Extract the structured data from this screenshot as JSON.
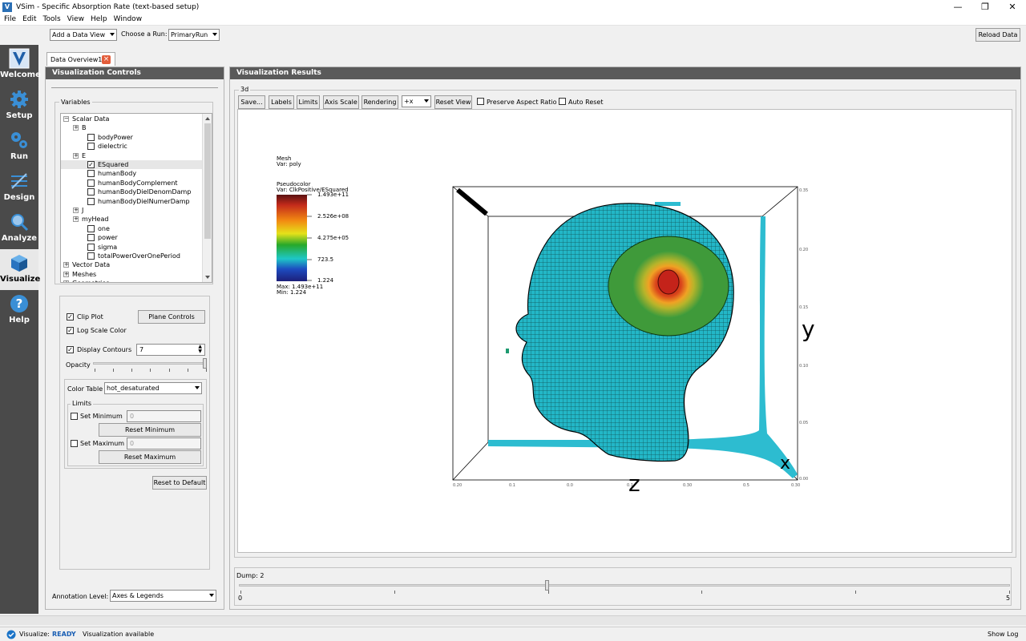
{
  "window": {
    "app_icon": "V",
    "title": "VSim - Specific Absorption Rate (text-based setup)",
    "controls": [
      "—",
      "❐",
      "✕"
    ]
  },
  "menu": [
    "File",
    "Edit",
    "Tools",
    "View",
    "Help",
    "Window"
  ],
  "toolbar": {
    "add_view": "Add a Data View",
    "choose_run_label": "Choose a Run:",
    "run_value": "PrimaryRun",
    "reload": "Reload Data"
  },
  "sidebar": {
    "items": [
      {
        "label": "Welcome",
        "icon": "vsim-logo-icon"
      },
      {
        "label": "Setup",
        "icon": "gear-icon"
      },
      {
        "label": "Run",
        "icon": "gears-icon"
      },
      {
        "label": "Design",
        "icon": "design-icon"
      },
      {
        "label": "Analyze",
        "icon": "magnifier-icon"
      },
      {
        "label": "Visualize",
        "icon": "cube-icon"
      },
      {
        "label": "Help",
        "icon": "question-icon"
      }
    ]
  },
  "tab": {
    "label": "Data Overview1"
  },
  "controls_panel": {
    "title": "Visualization Controls",
    "variables_label": "Variables",
    "tree": [
      {
        "indent": 0,
        "exp": "⊟",
        "label": "Scalar Data"
      },
      {
        "indent": 1,
        "exp": "⊞",
        "label": "B"
      },
      {
        "indent": 2,
        "cb": "",
        "label": "bodyPower"
      },
      {
        "indent": 2,
        "cb": "",
        "label": "dielectric"
      },
      {
        "indent": 1,
        "exp": "⊞",
        "label": "E"
      },
      {
        "indent": 2,
        "cb": "✓",
        "label": "ESquared",
        "sel": true
      },
      {
        "indent": 2,
        "cb": "",
        "label": "humanBody"
      },
      {
        "indent": 2,
        "cb": "",
        "label": "humanBodyComplement"
      },
      {
        "indent": 2,
        "cb": "",
        "label": "humanBodyDielDenomDamp"
      },
      {
        "indent": 2,
        "cb": "",
        "label": "humanBodyDielNumerDamp"
      },
      {
        "indent": 1,
        "exp": "⊞",
        "label": "J"
      },
      {
        "indent": 1,
        "exp": "⊞",
        "label": "myHead"
      },
      {
        "indent": 2,
        "cb": "",
        "label": "one"
      },
      {
        "indent": 2,
        "cb": "",
        "label": "power"
      },
      {
        "indent": 2,
        "cb": "",
        "label": "sigma"
      },
      {
        "indent": 2,
        "cb": "",
        "label": "totalPowerOverOnePeriod"
      },
      {
        "indent": 0,
        "exp": "⊞",
        "label": "Vector Data"
      },
      {
        "indent": 0,
        "exp": "⊞",
        "label": "Meshes"
      },
      {
        "indent": 0,
        "exp": "⊞",
        "label": "Geometries"
      }
    ],
    "clip_plot": "Clip Plot",
    "plane_controls": "Plane Controls",
    "log_scale": "Log Scale Color",
    "display_contours": "Display Contours",
    "contours_value": "7",
    "opacity": "Opacity",
    "color_table_label": "Color Table",
    "color_table_value": "hot_desaturated",
    "limits_label": "Limits",
    "set_min": "Set Minimum",
    "min_value": "0",
    "reset_min": "Reset Minimum",
    "set_max": "Set Maximum",
    "max_value": "0",
    "reset_max": "Reset Maximum",
    "reset_default": "Reset to Default",
    "annotation_label": "Annotation Level:",
    "annotation_value": "Axes & Legends"
  },
  "results_panel": {
    "title": "Visualization Results",
    "group": "3d",
    "buttons": [
      "Save...",
      "Labels",
      "Limits",
      "Axis Scale",
      "Rendering"
    ],
    "axis_value": "+x",
    "reset_view": "Reset View",
    "preserve_aspect": "Preserve Aspect Ratio",
    "auto_reset": "Auto Reset",
    "legend": {
      "mesh": "Mesh",
      "mesh_var": "Var: poly",
      "pseudo": "Pseudocolor",
      "pseudo_var": "Var: ClkPositive/ESquared",
      "ticks": [
        "1.493e+11",
        "2.526e+08",
        "4.275e+05",
        "723.5",
        "1.224"
      ],
      "max": "Max:  1.493e+11",
      "min": "Min:  1.224"
    },
    "axes": {
      "y": "y",
      "z": "z",
      "x": "x"
    },
    "dump_label": "Dump: 2",
    "dump_min": "0",
    "dump_max": "5",
    "dump_value": 2
  },
  "status": {
    "prefix": "Visualize:",
    "state": "READY",
    "message": "Visualization available",
    "show_log": "Show Log"
  },
  "colors": {
    "sidebar": "#4a4a4a",
    "header": "#5a5a5a",
    "ready": "#1a5fb4"
  }
}
